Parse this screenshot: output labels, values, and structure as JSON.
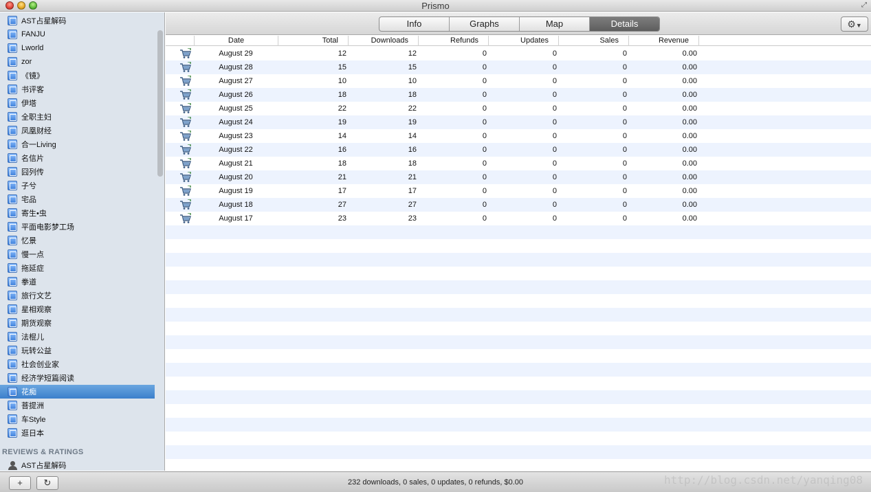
{
  "window": {
    "title": "Prismo"
  },
  "sidebar": {
    "apps": [
      {
        "label": "AST占星解码"
      },
      {
        "label": "FANJU"
      },
      {
        "label": "Lworld"
      },
      {
        "label": "zor"
      },
      {
        "label": "《镜》"
      },
      {
        "label": "书评客"
      },
      {
        "label": "伊塔"
      },
      {
        "label": "全职主妇"
      },
      {
        "label": "凤凰财经"
      },
      {
        "label": "合一Living"
      },
      {
        "label": "名信片"
      },
      {
        "label": "囧列传"
      },
      {
        "label": "子兮"
      },
      {
        "label": "宅品"
      },
      {
        "label": "寄生•虫"
      },
      {
        "label": "平面电影梦工场"
      },
      {
        "label": "忆景"
      },
      {
        "label": "慢一点"
      },
      {
        "label": "拖延症"
      },
      {
        "label": "拳道"
      },
      {
        "label": "旅行文艺"
      },
      {
        "label": "星相观察"
      },
      {
        "label": "期货观察"
      },
      {
        "label": "法棍儿"
      },
      {
        "label": "玩转公益"
      },
      {
        "label": "社会创业家"
      },
      {
        "label": "经济学短篇阅读"
      },
      {
        "label": "花痴",
        "selected": true
      },
      {
        "label": "菩提洲"
      },
      {
        "label": "车Style"
      },
      {
        "label": "逛日本"
      }
    ],
    "section_reviews": "REVIEWS & RATINGS",
    "review_items": [
      {
        "label": "AST占星解码"
      }
    ]
  },
  "tabs": [
    {
      "label": "Info"
    },
    {
      "label": "Graphs"
    },
    {
      "label": "Map"
    },
    {
      "label": "Details",
      "active": true
    }
  ],
  "table": {
    "columns": [
      "Date",
      "Total",
      "Downloads",
      "Refunds",
      "Updates",
      "Sales",
      "Revenue"
    ],
    "rows": [
      {
        "date": "August 29",
        "total": "12",
        "downloads": "12",
        "refunds": "0",
        "updates": "0",
        "sales": "0",
        "revenue": "0.00"
      },
      {
        "date": "August 28",
        "total": "15",
        "downloads": "15",
        "refunds": "0",
        "updates": "0",
        "sales": "0",
        "revenue": "0.00"
      },
      {
        "date": "August 27",
        "total": "10",
        "downloads": "10",
        "refunds": "0",
        "updates": "0",
        "sales": "0",
        "revenue": "0.00"
      },
      {
        "date": "August 26",
        "total": "18",
        "downloads": "18",
        "refunds": "0",
        "updates": "0",
        "sales": "0",
        "revenue": "0.00"
      },
      {
        "date": "August 25",
        "total": "22",
        "downloads": "22",
        "refunds": "0",
        "updates": "0",
        "sales": "0",
        "revenue": "0.00"
      },
      {
        "date": "August 24",
        "total": "19",
        "downloads": "19",
        "refunds": "0",
        "updates": "0",
        "sales": "0",
        "revenue": "0.00"
      },
      {
        "date": "August 23",
        "total": "14",
        "downloads": "14",
        "refunds": "0",
        "updates": "0",
        "sales": "0",
        "revenue": "0.00"
      },
      {
        "date": "August 22",
        "total": "16",
        "downloads": "16",
        "refunds": "0",
        "updates": "0",
        "sales": "0",
        "revenue": "0.00"
      },
      {
        "date": "August 21",
        "total": "18",
        "downloads": "18",
        "refunds": "0",
        "updates": "0",
        "sales": "0",
        "revenue": "0.00"
      },
      {
        "date": "August 20",
        "total": "21",
        "downloads": "21",
        "refunds": "0",
        "updates": "0",
        "sales": "0",
        "revenue": "0.00"
      },
      {
        "date": "August 19",
        "total": "17",
        "downloads": "17",
        "refunds": "0",
        "updates": "0",
        "sales": "0",
        "revenue": "0.00"
      },
      {
        "date": "August 18",
        "total": "27",
        "downloads": "27",
        "refunds": "0",
        "updates": "0",
        "sales": "0",
        "revenue": "0.00"
      },
      {
        "date": "August 17",
        "total": "23",
        "downloads": "23",
        "refunds": "0",
        "updates": "0",
        "sales": "0",
        "revenue": "0.00"
      }
    ]
  },
  "bottom_bar": {
    "add_label": "+",
    "refresh_label": "↻",
    "status": "232 downloads, 0 sales, 0 updates, 0 refunds, $0.00",
    "watermark": "http://blog.csdn.net/yanqing08"
  },
  "icons": {
    "gear": "gear-icon",
    "app": "app-store-icon",
    "cart": "cart-download-icon"
  },
  "colors": {
    "selection": "#3b7fcb",
    "sidebar_bg": "#dde4ec",
    "row_alt": "#edf3fe",
    "active_tab": "#5e5e5e"
  }
}
